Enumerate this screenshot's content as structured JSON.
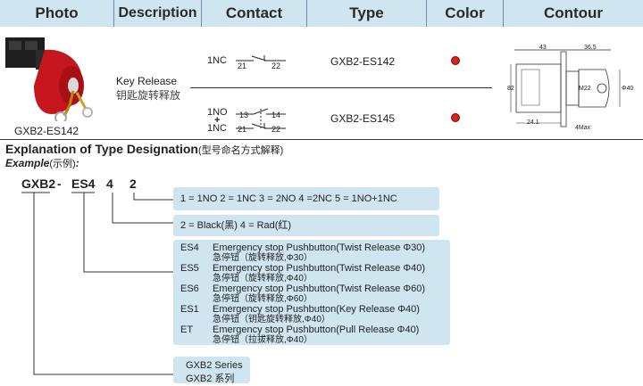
{
  "header": {
    "photo": "Photo",
    "description": "Description",
    "contact": "Contact",
    "type": "Type",
    "color": "Color",
    "contour": "Contour"
  },
  "product": {
    "photo_caption": "GXB2-ES142",
    "description_en": "Key Release",
    "description_cn": "钥匙旋转释放",
    "rows": [
      {
        "contact": "1NC",
        "pins_a": [
          "21",
          "22"
        ],
        "type": "GXB2-ES142",
        "color": "#d8201c"
      },
      {
        "contact_top": "1NO",
        "contact_plus": "+",
        "contact_bottom": "1NC",
        "pins_a": [
          "13",
          "14"
        ],
        "pins_b": [
          "21",
          "22"
        ],
        "type": "GXB2-ES145",
        "color": "#d8201c"
      }
    ],
    "contour_dims": {
      "top_left": "43",
      "top_right": "36.5",
      "left": "82",
      "bottom": "24.1",
      "side": "4Max",
      "center": "M22",
      "right": "Φ40"
    }
  },
  "explanation": {
    "title_en": "Explanation of Type Designation",
    "title_cn": "(型号命名方式解释)",
    "example_en": "Example",
    "example_cn": "(示例)",
    "example_colon": ":",
    "code": {
      "series": "GXB2",
      "dash": "-",
      "model": "ES4",
      "color": "4",
      "contact": "2"
    },
    "contact_box": "1 = 1NO   2 = 1NC   3 = 2NO 4 =2NC 5 = 1NO+1NC",
    "color_box": "2 = Black(黑)   4 = Rad(红)",
    "models": [
      {
        "code": "ES4",
        "en": "Emergency stop Pushbutton(Twist Release Φ30)",
        "cn": "急停钮（旋转释放,Φ30）"
      },
      {
        "code": "ES5",
        "en": "Emergency stop Pushbutton(Twist Release Φ40)",
        "cn": "急停钮（旋转释放,Φ40）"
      },
      {
        "code": "ES6",
        "en": "Emergency stop Pushbutton(Twist Release Φ60)",
        "cn": "急停钮（旋转释放,Φ60）"
      },
      {
        "code": "ES1",
        "en": "Emergency stop Pushbutton(Key Release    Φ40)",
        "cn": "急停钮（钥匙旋转释放,Φ40）"
      },
      {
        "code": "ET",
        "en": "Emergency stop Pushbutton(Pull Release   Φ40)",
        "cn": "急停钮（拉拔释放,Φ40）"
      }
    ],
    "series_en": "GXB2 Series",
    "series_cn": "GXB2 系列"
  }
}
